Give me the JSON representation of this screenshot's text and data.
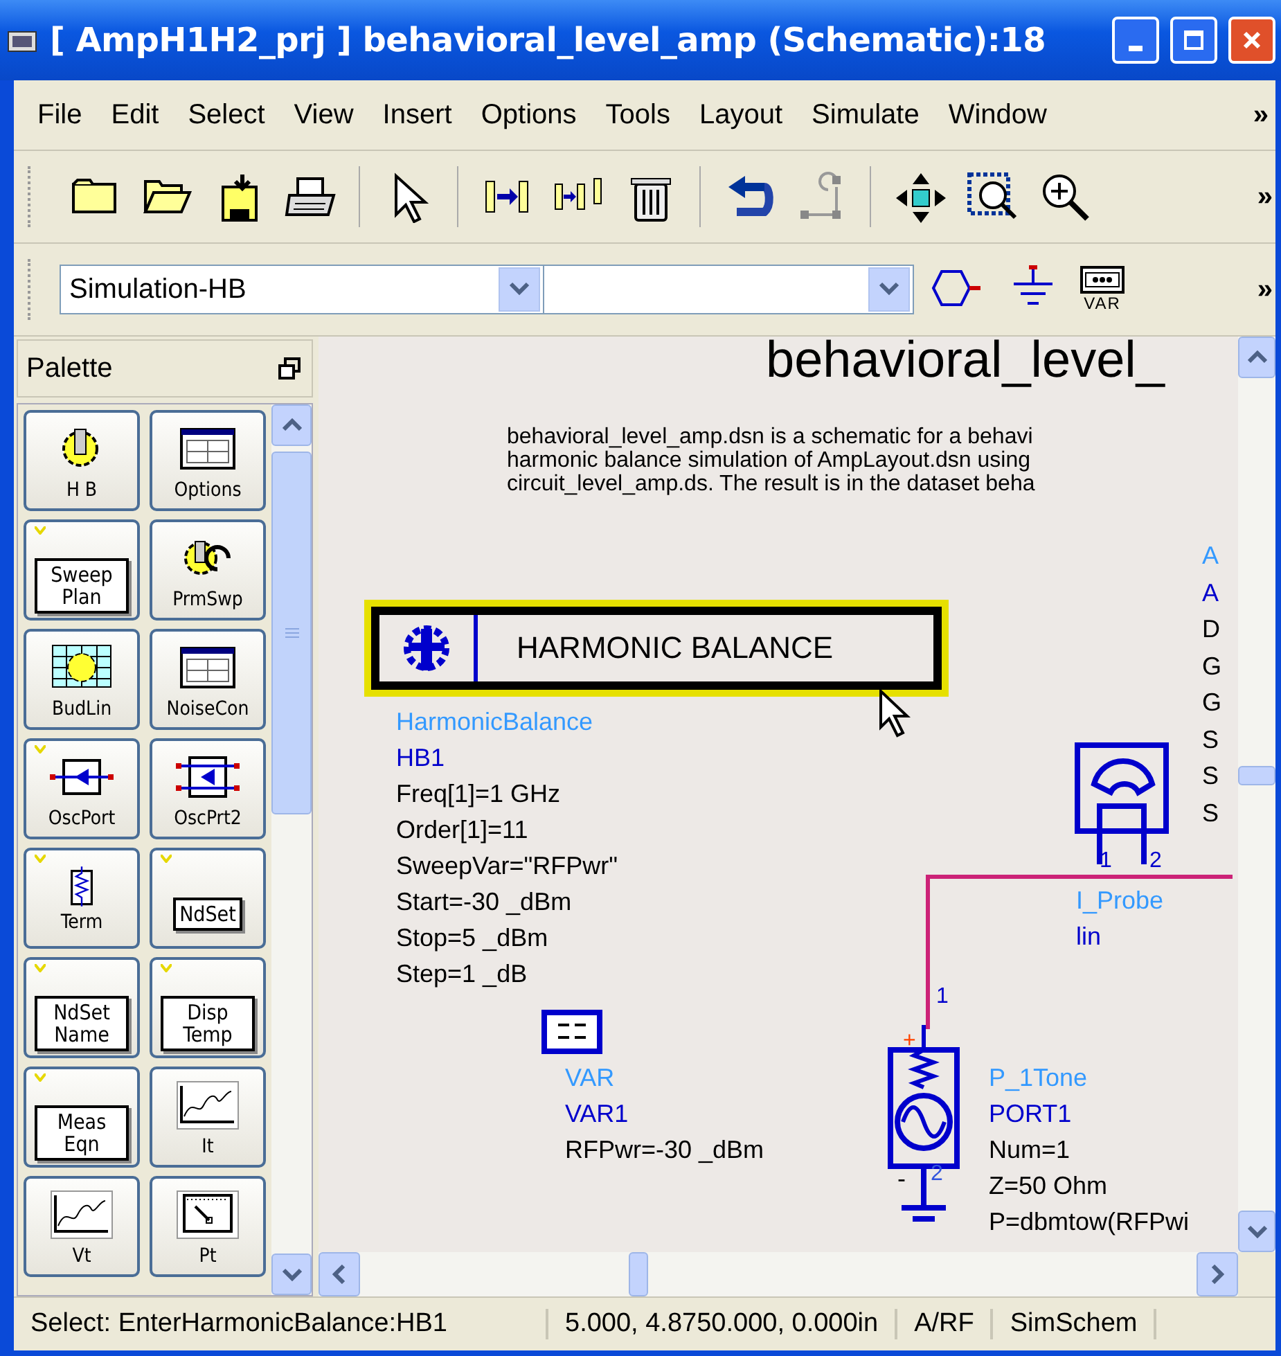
{
  "window": {
    "title": "[ AmpH1H2_prj ] behavioral_level_amp (Schematic):18"
  },
  "menu": {
    "items": [
      "File",
      "Edit",
      "Select",
      "View",
      "Insert",
      "Options",
      "Tools",
      "Layout",
      "Simulate",
      "Window"
    ],
    "overflow": "»"
  },
  "toolbar": {
    "overflow": "»"
  },
  "library_bar": {
    "library": "Simulation-HB",
    "var_label": "VAR",
    "overflow": "»"
  },
  "palette": {
    "title": "Palette",
    "items": [
      {
        "label": "H B",
        "kind": "gear",
        "flagged": false
      },
      {
        "label": "Options",
        "kind": "window",
        "flagged": false
      },
      {
        "label": "Sweep Plan",
        "kind": "textbox",
        "flagged": true
      },
      {
        "label": "PrmSwp",
        "kind": "gearsweep",
        "flagged": false
      },
      {
        "label": "BudLin",
        "kind": "geargrid",
        "flagged": false
      },
      {
        "label": "NoiseCon",
        "kind": "window",
        "flagged": false
      },
      {
        "label": "OscPort",
        "kind": "port",
        "flagged": true
      },
      {
        "label": "OscPrt2",
        "kind": "port2",
        "flagged": false
      },
      {
        "label": "Term",
        "kind": "resistor",
        "flagged": true
      },
      {
        "label": "NdSet",
        "kind": "textbox",
        "flagged": true
      },
      {
        "label": "NdSet Name",
        "kind": "textbox",
        "flagged": true
      },
      {
        "label": "Disp Temp",
        "kind": "textbox",
        "flagged": true
      },
      {
        "label": "Meas Eqn",
        "kind": "textbox",
        "flagged": true
      },
      {
        "label": "It",
        "kind": "plot",
        "flagged": false
      },
      {
        "label": "Vt",
        "kind": "plot",
        "flagged": false
      },
      {
        "label": "Pt",
        "kind": "meter",
        "flagged": false
      }
    ]
  },
  "schematic": {
    "title": "behavioral_level_",
    "description": [
      "behavioral_level_amp.dsn is a schematic for a behavi",
      "harmonic balance simulation of AmpLayout.dsn using",
      "circuit_level_amp.ds. The result is in the dataset beha"
    ],
    "hb_block": {
      "label": "HARMONIC BALANCE",
      "selected": true
    },
    "hb_params": [
      {
        "text": "HarmonicBalance",
        "kind": "type"
      },
      {
        "text": "HB1",
        "kind": "name"
      },
      {
        "text": "Freq[1]=1 GHz",
        "kind": "param"
      },
      {
        "text": "Order[1]=11",
        "kind": "param"
      },
      {
        "text": "SweepVar=\"RFPwr\"",
        "kind": "param"
      },
      {
        "text": "Start=-30 _dBm",
        "kind": "param"
      },
      {
        "text": "Stop=5 _dBm",
        "kind": "param"
      },
      {
        "text": "Step=1 _dB",
        "kind": "param"
      }
    ],
    "var_params": [
      {
        "text": "VAR",
        "kind": "type"
      },
      {
        "text": "VAR1",
        "kind": "name"
      },
      {
        "text": "RFPwr=-30 _dBm",
        "kind": "param"
      }
    ],
    "probe": {
      "pins": [
        "1",
        "2"
      ],
      "params": [
        {
          "text": "I_Probe",
          "kind": "type"
        },
        {
          "text": "lin",
          "kind": "name"
        }
      ]
    },
    "port": {
      "pins": [
        "1",
        "2"
      ],
      "plus": "+",
      "minus": "-",
      "params": [
        {
          "text": "P_1Tone",
          "kind": "type"
        },
        {
          "text": "PORT1",
          "kind": "name"
        },
        {
          "text": "Num=1",
          "kind": "param"
        },
        {
          "text": "Z=50 Ohm",
          "kind": "param"
        },
        {
          "text": "P=dbmtow(RFPwi",
          "kind": "param"
        }
      ]
    },
    "edge_params": [
      {
        "text": "A",
        "kind": "type"
      },
      {
        "text": "A",
        "kind": "name"
      },
      {
        "text": "D",
        "kind": "param"
      },
      {
        "text": "G",
        "kind": "param"
      },
      {
        "text": "G",
        "kind": "param"
      },
      {
        "text": "S",
        "kind": "param"
      },
      {
        "text": "S",
        "kind": "param"
      },
      {
        "text": "S",
        "kind": "param"
      }
    ]
  },
  "status_bar": [
    "Select: EnterHarmonicBalance:HB1",
    "5.000, 4.8750.000, 0.000in",
    "A/RF",
    "SimSchem"
  ]
}
